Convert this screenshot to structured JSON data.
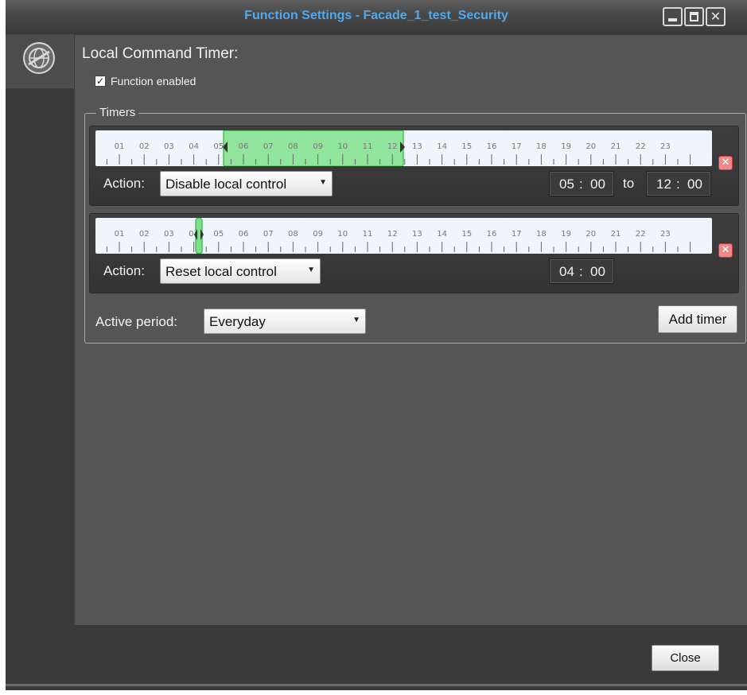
{
  "window": {
    "title": "Function Settings - Facade_1_test_Security",
    "controls": [
      "minimize-icon",
      "maximize-icon",
      "close-icon"
    ]
  },
  "sidebar": {
    "tabs": [
      {
        "icon": "settings-globe-icon",
        "selected": true
      }
    ]
  },
  "content": {
    "heading": "Local Command Timer:",
    "function_enabled": {
      "label": "Function enabled",
      "checked": true
    },
    "timers_group_label": "Timers",
    "timeline_hours": [
      "01",
      "02",
      "03",
      "04",
      "05",
      "06",
      "07",
      "08",
      "09",
      "10",
      "11",
      "12",
      "13",
      "14",
      "15",
      "16",
      "17",
      "18",
      "19",
      "20",
      "21",
      "22",
      "23"
    ],
    "timers": [
      {
        "action_label": "Action:",
        "action_value": "Disable local control",
        "from": {
          "hh": "05",
          "mm": "00"
        },
        "to_label": "to",
        "to": {
          "hh": "12",
          "mm": "00"
        }
      },
      {
        "action_label": "Action:",
        "action_value": "Reset local control",
        "at": {
          "hh": "04",
          "mm": "00"
        }
      }
    ],
    "active_period_label": "Active period:",
    "active_period_value": "Everyday",
    "add_timer_label": "Add timer"
  },
  "footer": {
    "close_label": "Close"
  },
  "colors": {
    "title": "#4fa9ec",
    "selection": "#7fe08a",
    "remove": "#f08a8a",
    "background": "#555555"
  }
}
